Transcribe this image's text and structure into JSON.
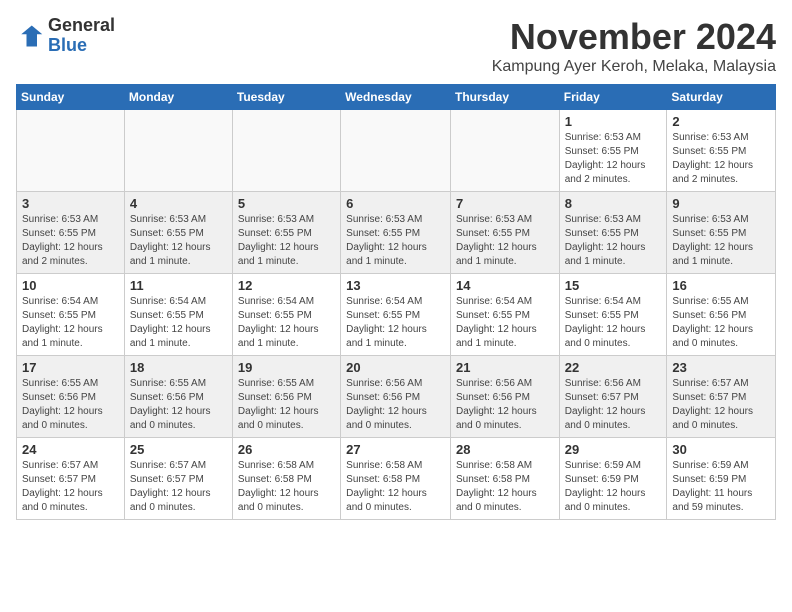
{
  "logo": {
    "general": "General",
    "blue": "Blue"
  },
  "title": "November 2024",
  "subtitle": "Kampung Ayer Keroh, Melaka, Malaysia",
  "headers": [
    "Sunday",
    "Monday",
    "Tuesday",
    "Wednesday",
    "Thursday",
    "Friday",
    "Saturday"
  ],
  "rows": [
    [
      {
        "day": "",
        "info": ""
      },
      {
        "day": "",
        "info": ""
      },
      {
        "day": "",
        "info": ""
      },
      {
        "day": "",
        "info": ""
      },
      {
        "day": "",
        "info": ""
      },
      {
        "day": "1",
        "info": "Sunrise: 6:53 AM\nSunset: 6:55 PM\nDaylight: 12 hours and 2 minutes."
      },
      {
        "day": "2",
        "info": "Sunrise: 6:53 AM\nSunset: 6:55 PM\nDaylight: 12 hours and 2 minutes."
      }
    ],
    [
      {
        "day": "3",
        "info": "Sunrise: 6:53 AM\nSunset: 6:55 PM\nDaylight: 12 hours and 2 minutes."
      },
      {
        "day": "4",
        "info": "Sunrise: 6:53 AM\nSunset: 6:55 PM\nDaylight: 12 hours and 1 minute."
      },
      {
        "day": "5",
        "info": "Sunrise: 6:53 AM\nSunset: 6:55 PM\nDaylight: 12 hours and 1 minute."
      },
      {
        "day": "6",
        "info": "Sunrise: 6:53 AM\nSunset: 6:55 PM\nDaylight: 12 hours and 1 minute."
      },
      {
        "day": "7",
        "info": "Sunrise: 6:53 AM\nSunset: 6:55 PM\nDaylight: 12 hours and 1 minute."
      },
      {
        "day": "8",
        "info": "Sunrise: 6:53 AM\nSunset: 6:55 PM\nDaylight: 12 hours and 1 minute."
      },
      {
        "day": "9",
        "info": "Sunrise: 6:53 AM\nSunset: 6:55 PM\nDaylight: 12 hours and 1 minute."
      }
    ],
    [
      {
        "day": "10",
        "info": "Sunrise: 6:54 AM\nSunset: 6:55 PM\nDaylight: 12 hours and 1 minute."
      },
      {
        "day": "11",
        "info": "Sunrise: 6:54 AM\nSunset: 6:55 PM\nDaylight: 12 hours and 1 minute."
      },
      {
        "day": "12",
        "info": "Sunrise: 6:54 AM\nSunset: 6:55 PM\nDaylight: 12 hours and 1 minute."
      },
      {
        "day": "13",
        "info": "Sunrise: 6:54 AM\nSunset: 6:55 PM\nDaylight: 12 hours and 1 minute."
      },
      {
        "day": "14",
        "info": "Sunrise: 6:54 AM\nSunset: 6:55 PM\nDaylight: 12 hours and 1 minute."
      },
      {
        "day": "15",
        "info": "Sunrise: 6:54 AM\nSunset: 6:55 PM\nDaylight: 12 hours and 0 minutes."
      },
      {
        "day": "16",
        "info": "Sunrise: 6:55 AM\nSunset: 6:56 PM\nDaylight: 12 hours and 0 minutes."
      }
    ],
    [
      {
        "day": "17",
        "info": "Sunrise: 6:55 AM\nSunset: 6:56 PM\nDaylight: 12 hours and 0 minutes."
      },
      {
        "day": "18",
        "info": "Sunrise: 6:55 AM\nSunset: 6:56 PM\nDaylight: 12 hours and 0 minutes."
      },
      {
        "day": "19",
        "info": "Sunrise: 6:55 AM\nSunset: 6:56 PM\nDaylight: 12 hours and 0 minutes."
      },
      {
        "day": "20",
        "info": "Sunrise: 6:56 AM\nSunset: 6:56 PM\nDaylight: 12 hours and 0 minutes."
      },
      {
        "day": "21",
        "info": "Sunrise: 6:56 AM\nSunset: 6:56 PM\nDaylight: 12 hours and 0 minutes."
      },
      {
        "day": "22",
        "info": "Sunrise: 6:56 AM\nSunset: 6:57 PM\nDaylight: 12 hours and 0 minutes."
      },
      {
        "day": "23",
        "info": "Sunrise: 6:57 AM\nSunset: 6:57 PM\nDaylight: 12 hours and 0 minutes."
      }
    ],
    [
      {
        "day": "24",
        "info": "Sunrise: 6:57 AM\nSunset: 6:57 PM\nDaylight: 12 hours and 0 minutes."
      },
      {
        "day": "25",
        "info": "Sunrise: 6:57 AM\nSunset: 6:57 PM\nDaylight: 12 hours and 0 minutes."
      },
      {
        "day": "26",
        "info": "Sunrise: 6:58 AM\nSunset: 6:58 PM\nDaylight: 12 hours and 0 minutes."
      },
      {
        "day": "27",
        "info": "Sunrise: 6:58 AM\nSunset: 6:58 PM\nDaylight: 12 hours and 0 minutes."
      },
      {
        "day": "28",
        "info": "Sunrise: 6:58 AM\nSunset: 6:58 PM\nDaylight: 12 hours and 0 minutes."
      },
      {
        "day": "29",
        "info": "Sunrise: 6:59 AM\nSunset: 6:59 PM\nDaylight: 12 hours and 0 minutes."
      },
      {
        "day": "30",
        "info": "Sunrise: 6:59 AM\nSunset: 6:59 PM\nDaylight: 11 hours and 59 minutes."
      }
    ]
  ],
  "colors": {
    "header_bg": "#2a6db5",
    "header_text": "#ffffff",
    "shaded_row": "#f0f0f0",
    "border": "#cccccc"
  }
}
